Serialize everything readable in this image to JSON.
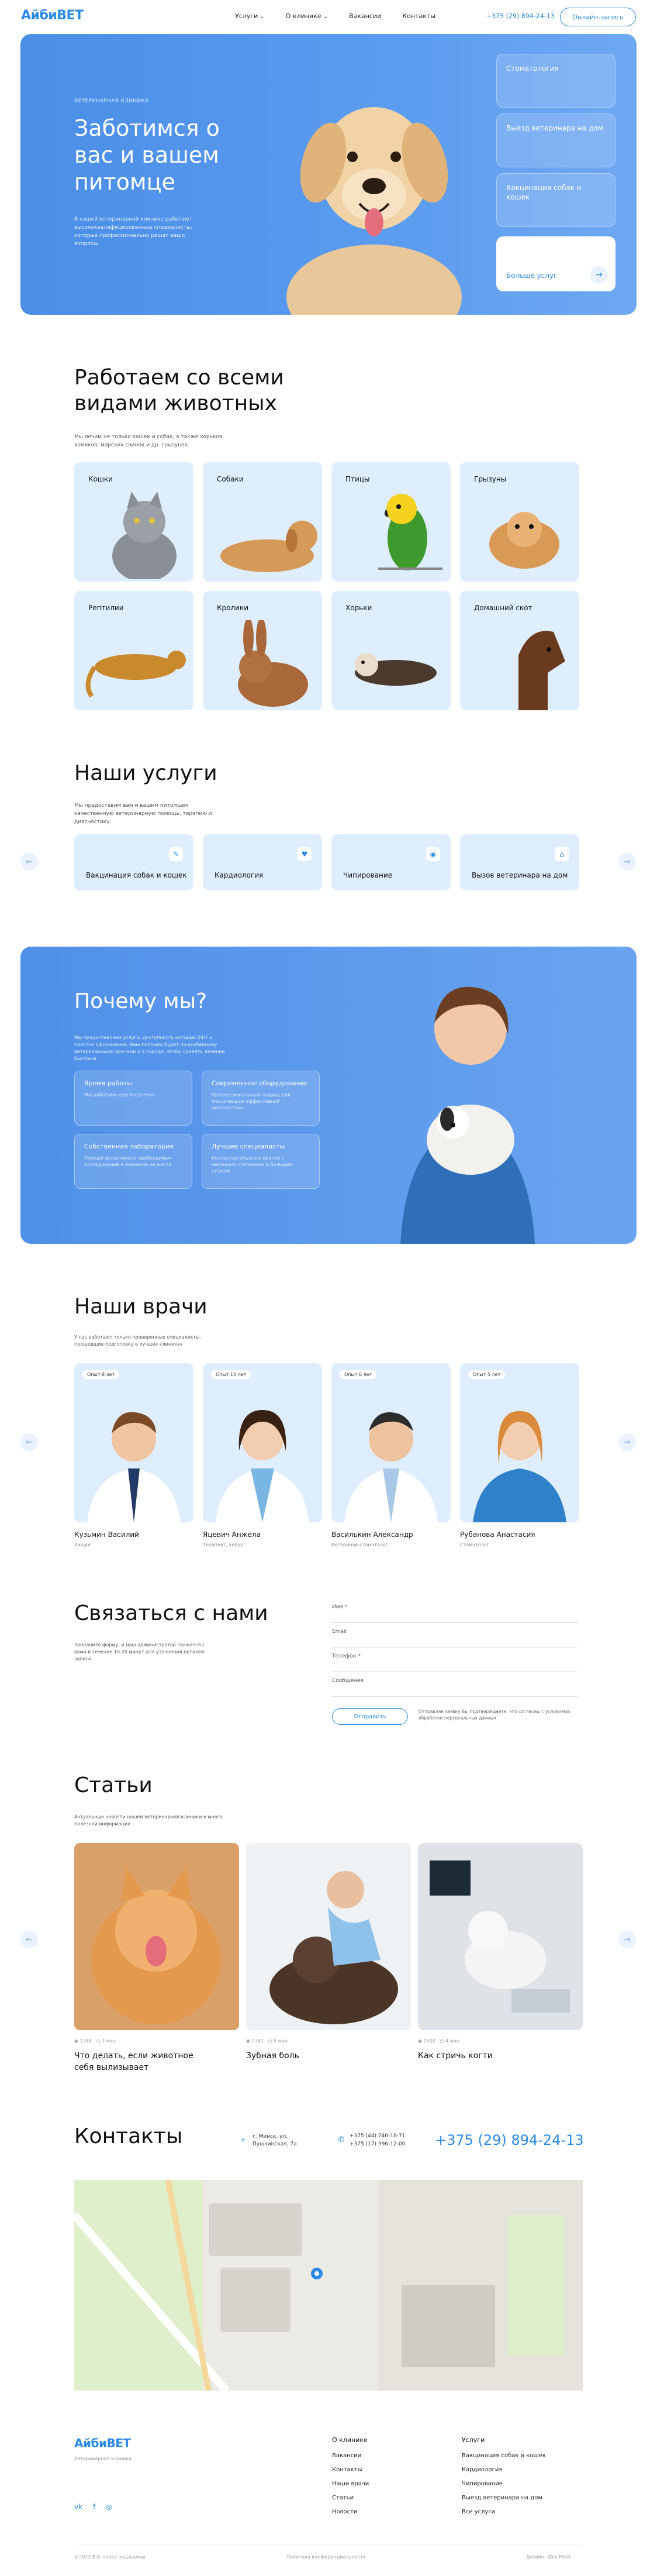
{
  "header": {
    "logo": "АйбиВЕТ",
    "nav": [
      "Услуги",
      "О клинике",
      "Вакансии",
      "Контакты"
    ],
    "phone": "+375 (29) 894-24-13",
    "cta": "Онлайн-запись"
  },
  "hero": {
    "kicker": "ВЕТЕРИНАРНАЯ КЛИНИКА",
    "title": "Заботимся о вас и вашем питомце",
    "desc": "В нашей ветеринарной клинике работают высококвалифицированные специалисты, которые профессионально решат ваши вопросы.",
    "cards": [
      "Стоматология",
      "Выезд ветеринара на дом",
      "Вакцинация собак и кошек"
    ],
    "more": "Больше услуг"
  },
  "animals": {
    "title": "Работаем со всеми видами животных",
    "sub": "Мы лечим не только кошек и собак, а также хорьков, хомяков, морских свинок и др. грызунов.",
    "items": [
      "Кошки",
      "Собаки",
      "Птицы",
      "Грызуны",
      "Рептилии",
      "Кролики",
      "Хорьки",
      "Домашний скот"
    ]
  },
  "services": {
    "title": "Наши услуги",
    "sub": "Мы предоставим вам и вашим питомцам качественную ветеринарную помощь, терапию и диагностику.",
    "items": [
      "Вакцинация собак и кошек",
      "Кардиология",
      "Чипирование",
      "Вызов ветеринара на дом"
    ]
  },
  "why": {
    "title": "Почему мы?",
    "sub": "Мы предоставляем услуги, доступность которых 24/7 и простое оформление. Ваш питомец будет по-особенному ветеринарными врачами и в городе, чтобы сделать лечение быстрым.",
    "cards": [
      {
        "t": "Время работы",
        "d": "Мы работаем круглосуточно"
      },
      {
        "t": "Современное оборудование",
        "d": "Профессиональный подход для максимально эффективной диагностики"
      },
      {
        "t": "Собственная лаборатория",
        "d": "Полный ассортимент необходимых исследований и анализов на месте"
      },
      {
        "t": "Лучшие специалисты",
        "d": "Коллектив опытных врачей с научными степенями и большим стажем"
      }
    ]
  },
  "doctors": {
    "title": "Наши врачи",
    "sub": "У нас работают только проверенные специалисты, прошедшие подготовку в лучших клиниках",
    "items": [
      {
        "exp": "Опыт 8 лет",
        "name": "Кузьмин Василий",
        "role": "Хирург"
      },
      {
        "exp": "Опыт 10 лет",
        "name": "Яцевич Анжела",
        "role": "Терапевт, хирург"
      },
      {
        "exp": "Опыт 6 лет",
        "name": "Василькин Александр",
        "role": "Ветеринар-стоматолог"
      },
      {
        "exp": "Опыт 5 лет",
        "name": "Рубанова Анастасия",
        "role": "Стоматолог"
      }
    ]
  },
  "contact": {
    "title": "Связаться с нами",
    "sub": "Заполните форму, и наш администратор свяжется с вами в течение 10-20 минут для уточнения деталей записи.",
    "fields": [
      "Имя *",
      "Email",
      "Телефон *",
      "Сообщение"
    ],
    "send": "Отправить",
    "consent": "Отправляя заявку Вы подтверждаете, что согласны с условиями обработки персональных данных"
  },
  "articles": {
    "title": "Статьи",
    "sub": "Актуальные новости нашей ветеринарной клиники и много полезной информации.",
    "items": [
      {
        "views": "1348",
        "comments": "3 мин",
        "title": "Что делать, если животное себя вылизывает"
      },
      {
        "views": "2341",
        "comments": "5 мин",
        "title": "Зубная боль"
      },
      {
        "views": "1500",
        "comments": "4 мин",
        "title": "Как стричь когти"
      }
    ]
  },
  "contacts": {
    "title": "Контакты",
    "address": "г. Минск, ул. Пушкинская, 7а",
    "phones": [
      "+375 (44) 740-18-71",
      "+375 (17) 396-12-00"
    ],
    "main_phone": "+375 (29) 894-24-13"
  },
  "footer": {
    "logo": "АйбиВЕТ",
    "tagline": "Ветеринарная клиника",
    "col1_title": "О клинике",
    "col1": [
      "Вакансии",
      "Контакты",
      "Наши врачи",
      "Статьи",
      "Новости"
    ],
    "col2_title": "Услуги",
    "col2": [
      "Вакцинация собак и кошек",
      "Кардиология",
      "Чипирование",
      "Выезд ветеринара на дом",
      "Все услуги"
    ],
    "copyright": "©2023 Все права защищены",
    "privacy": "Политика конфиденциальности",
    "design": "Дизайн: Web Point"
  }
}
